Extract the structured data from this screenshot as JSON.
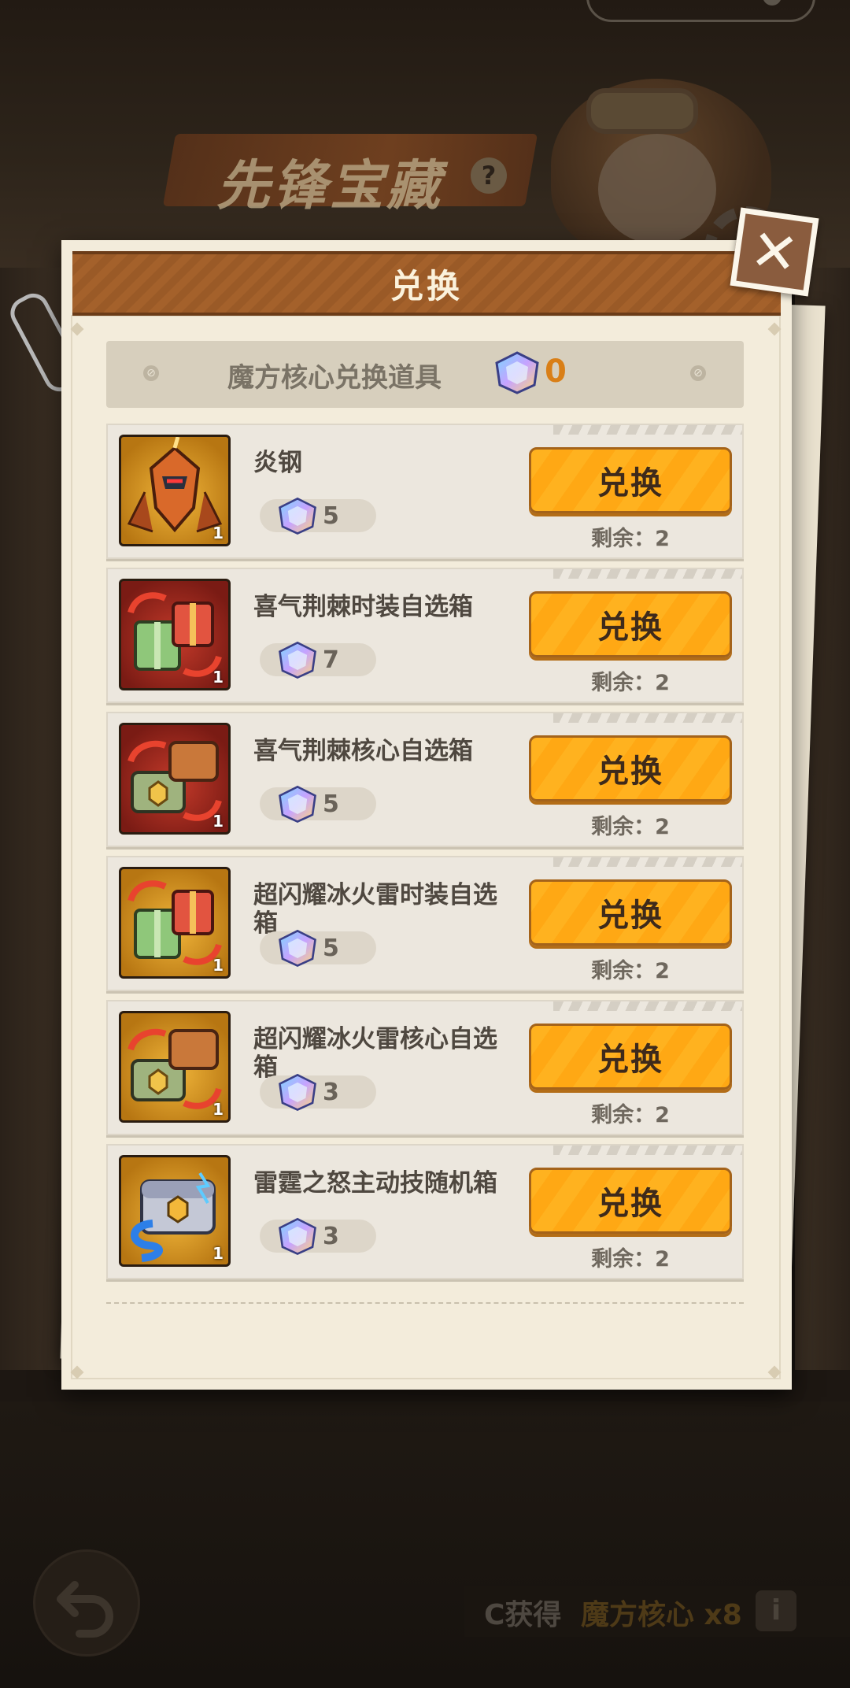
{
  "background": {
    "event_title": "先锋宝藏",
    "help_symbol": "?",
    "countdown": "",
    "back_icon": "undo-arrow",
    "bottom_source_label": "C获得",
    "bottom_source_item": "魔方核心 x8",
    "info_symbol": "i"
  },
  "modal": {
    "title": "兑换",
    "close_symbol": "✕",
    "currency": {
      "label": "魔方核心兑换道具",
      "count": "0"
    },
    "items": [
      {
        "name": "炎钢",
        "cost": "5",
        "button": "兑换",
        "remaining": "剩余：2",
        "icon": "mecha-robot",
        "quantity": "1",
        "frame": "gold"
      },
      {
        "name": "喜气荆棘时装自选箱",
        "cost": "7",
        "button": "兑换",
        "remaining": "剩余：2",
        "icon": "gift-box-choice",
        "quantity": "1",
        "frame": "red"
      },
      {
        "name": "喜气荆棘核心自选箱",
        "cost": "5",
        "button": "兑换",
        "remaining": "剩余：2",
        "icon": "core-chest-choice",
        "quantity": "1",
        "frame": "red"
      },
      {
        "name": "超闪耀冰火雷时装自选箱",
        "cost": "5",
        "button": "兑换",
        "remaining": "剩余：2",
        "icon": "gift-box-choice",
        "quantity": "1",
        "frame": "gold"
      },
      {
        "name": "超闪耀冰火雷核心自选箱",
        "cost": "3",
        "button": "兑换",
        "remaining": "剩余：2",
        "icon": "core-chest-choice",
        "quantity": "1",
        "frame": "gold"
      },
      {
        "name": "雷霆之怒主动技随机箱",
        "cost": "3",
        "button": "兑换",
        "remaining": "剩余：2",
        "icon": "thunder-chest",
        "quantity": "1",
        "frame": "gold"
      }
    ]
  },
  "colors": {
    "accent_orange": "#ffa814",
    "currency_count": "#d97f17",
    "header_brown": "#a4612b"
  }
}
